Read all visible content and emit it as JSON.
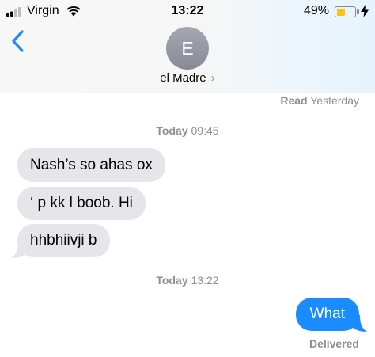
{
  "status_bar": {
    "carrier": "Virgin",
    "time": "13:22",
    "battery_percent": "49%",
    "battery_level": 0.49,
    "signal_icon": "signal-bars-icon",
    "wifi_icon": "wifi-icon",
    "charging_icon": "lightning-bolt-icon"
  },
  "header": {
    "back_icon": "chevron-left-icon",
    "avatar_initial": "E",
    "contact_name": "el Madre",
    "contact_chevron": "›"
  },
  "conversation": {
    "read_receipt": {
      "label": "Read",
      "when": "Yesterday"
    },
    "timestamps": [
      {
        "day": "Today",
        "time": "09:45"
      },
      {
        "day": "Today",
        "time": "13:22"
      }
    ],
    "incoming": [
      "Nash’s so ahas ox",
      "‘  p kk l boob. Hi",
      "hhbhiivji b"
    ],
    "outgoing": [
      "What"
    ],
    "delivery_status": "Delivered"
  },
  "colors": {
    "accent_blue": "#1a8cff",
    "incoming_bubble": "#e5e5ea",
    "secondary_text": "#8e8e93",
    "battery_yellow": "#f8c31b"
  }
}
